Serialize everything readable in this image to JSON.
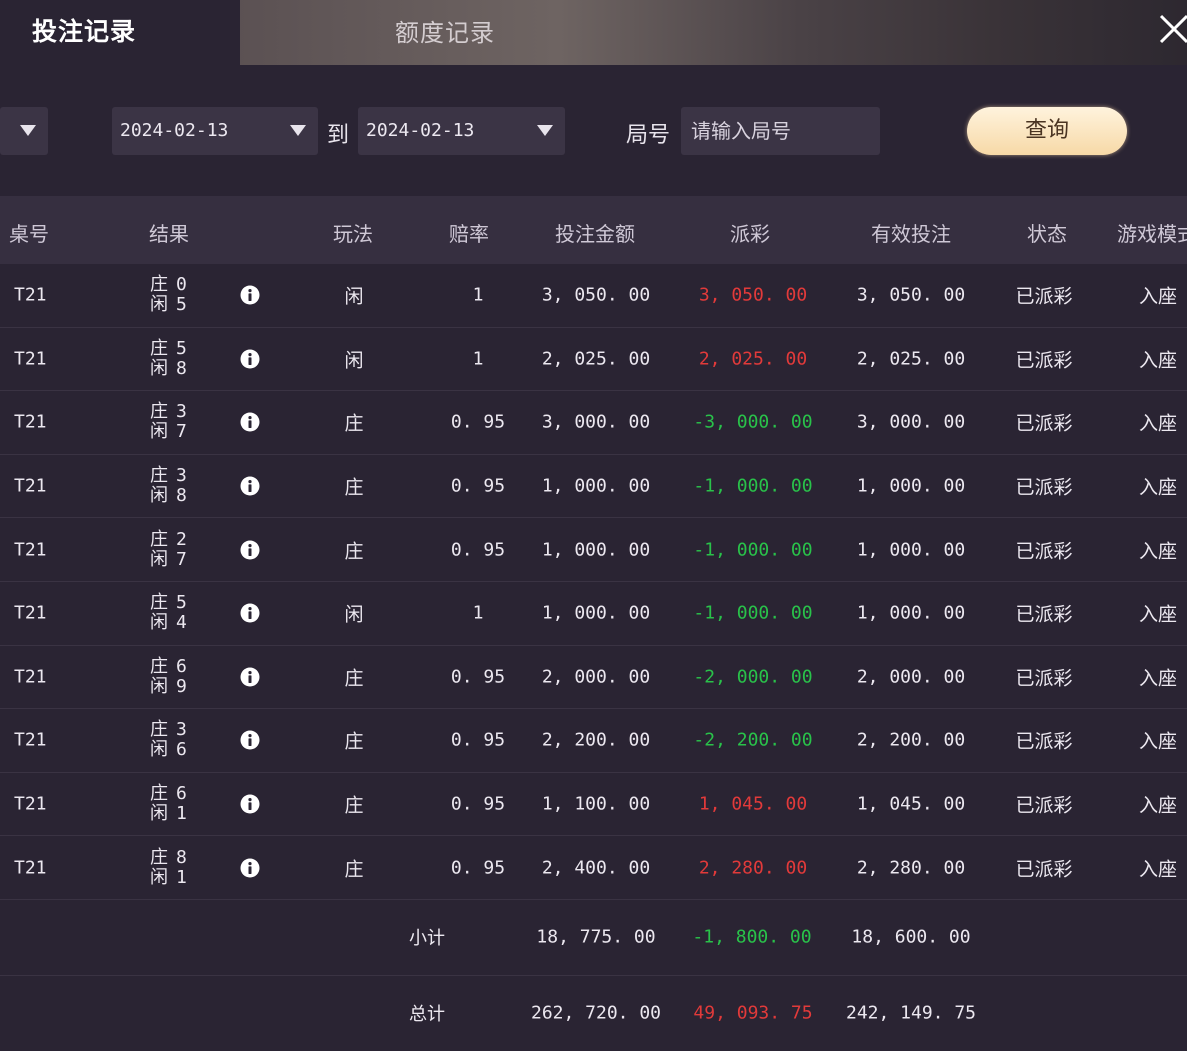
{
  "tabs": {
    "active": "投注记录",
    "inactive": "额度记录"
  },
  "filters": {
    "date_from": "2024-02-13",
    "to_label": "到",
    "date_to": "2024-02-13",
    "round_label": "局号",
    "round_placeholder": "请输入局号",
    "query_label": "查询"
  },
  "table": {
    "headers": {
      "table_no": "桌号",
      "result": "结果",
      "play": "玩法",
      "odds": "赔率",
      "bet": "投注金额",
      "payout": "派彩",
      "valid_bet": "有效投注",
      "status": "状态",
      "game_mode": "游戏模式"
    },
    "rows": [
      {
        "table_no": "T21",
        "banker_label": "庄",
        "banker": "0",
        "player_label": "闲",
        "player": "5",
        "play": "闲",
        "odds": "1",
        "bet": "3, 050. 00",
        "payout": "3, 050. 00",
        "payout_sign": "pos",
        "valid_bet": "3, 050. 00",
        "status": "已派彩",
        "game_mode": "入座"
      },
      {
        "table_no": "T21",
        "banker_label": "庄",
        "banker": "5",
        "player_label": "闲",
        "player": "8",
        "play": "闲",
        "odds": "1",
        "bet": "2, 025. 00",
        "payout": "2, 025. 00",
        "payout_sign": "pos",
        "valid_bet": "2, 025. 00",
        "status": "已派彩",
        "game_mode": "入座"
      },
      {
        "table_no": "T21",
        "banker_label": "庄",
        "banker": "3",
        "player_label": "闲",
        "player": "7",
        "play": "庄",
        "odds": "0. 95",
        "bet": "3, 000. 00",
        "payout": "-3, 000. 00",
        "payout_sign": "neg",
        "valid_bet": "3, 000. 00",
        "status": "已派彩",
        "game_mode": "入座"
      },
      {
        "table_no": "T21",
        "banker_label": "庄",
        "banker": "3",
        "player_label": "闲",
        "player": "8",
        "play": "庄",
        "odds": "0. 95",
        "bet": "1, 000. 00",
        "payout": "-1, 000. 00",
        "payout_sign": "neg",
        "valid_bet": "1, 000. 00",
        "status": "已派彩",
        "game_mode": "入座"
      },
      {
        "table_no": "T21",
        "banker_label": "庄",
        "banker": "2",
        "player_label": "闲",
        "player": "7",
        "play": "庄",
        "odds": "0. 95",
        "bet": "1, 000. 00",
        "payout": "-1, 000. 00",
        "payout_sign": "neg",
        "valid_bet": "1, 000. 00",
        "status": "已派彩",
        "game_mode": "入座"
      },
      {
        "table_no": "T21",
        "banker_label": "庄",
        "banker": "5",
        "player_label": "闲",
        "player": "4",
        "play": "闲",
        "odds": "1",
        "bet": "1, 000. 00",
        "payout": "-1, 000. 00",
        "payout_sign": "neg",
        "valid_bet": "1, 000. 00",
        "status": "已派彩",
        "game_mode": "入座"
      },
      {
        "table_no": "T21",
        "banker_label": "庄",
        "banker": "6",
        "player_label": "闲",
        "player": "9",
        "play": "庄",
        "odds": "0. 95",
        "bet": "2, 000. 00",
        "payout": "-2, 000. 00",
        "payout_sign": "neg",
        "valid_bet": "2, 000. 00",
        "status": "已派彩",
        "game_mode": "入座"
      },
      {
        "table_no": "T21",
        "banker_label": "庄",
        "banker": "3",
        "player_label": "闲",
        "player": "6",
        "play": "庄",
        "odds": "0. 95",
        "bet": "2, 200. 00",
        "payout": "-2, 200. 00",
        "payout_sign": "neg",
        "valid_bet": "2, 200. 00",
        "status": "已派彩",
        "game_mode": "入座"
      },
      {
        "table_no": "T21",
        "banker_label": "庄",
        "banker": "6",
        "player_label": "闲",
        "player": "1",
        "play": "庄",
        "odds": "0. 95",
        "bet": "1, 100. 00",
        "payout": "1, 045. 00",
        "payout_sign": "pos",
        "valid_bet": "1, 045. 00",
        "status": "已派彩",
        "game_mode": "入座"
      },
      {
        "table_no": "T21",
        "banker_label": "庄",
        "banker": "8",
        "player_label": "闲",
        "player": "1",
        "play": "庄",
        "odds": "0. 95",
        "bet": "2, 400. 00",
        "payout": "2, 280. 00",
        "payout_sign": "pos",
        "valid_bet": "2, 280. 00",
        "status": "已派彩",
        "game_mode": "入座"
      }
    ],
    "subtotal": {
      "label": "小计",
      "bet": "18, 775. 00",
      "payout": "-1, 800. 00",
      "payout_sign": "neg",
      "valid_bet": "18, 600. 00"
    },
    "total": {
      "label": "总计",
      "bet": "262, 720. 00",
      "payout": "49, 093. 75",
      "payout_sign": "pos",
      "valid_bet": "242, 149. 75"
    }
  },
  "colors": {
    "positive": "#e23a3a",
    "negative": "#29c24a",
    "accent": "#f7d9a7"
  }
}
